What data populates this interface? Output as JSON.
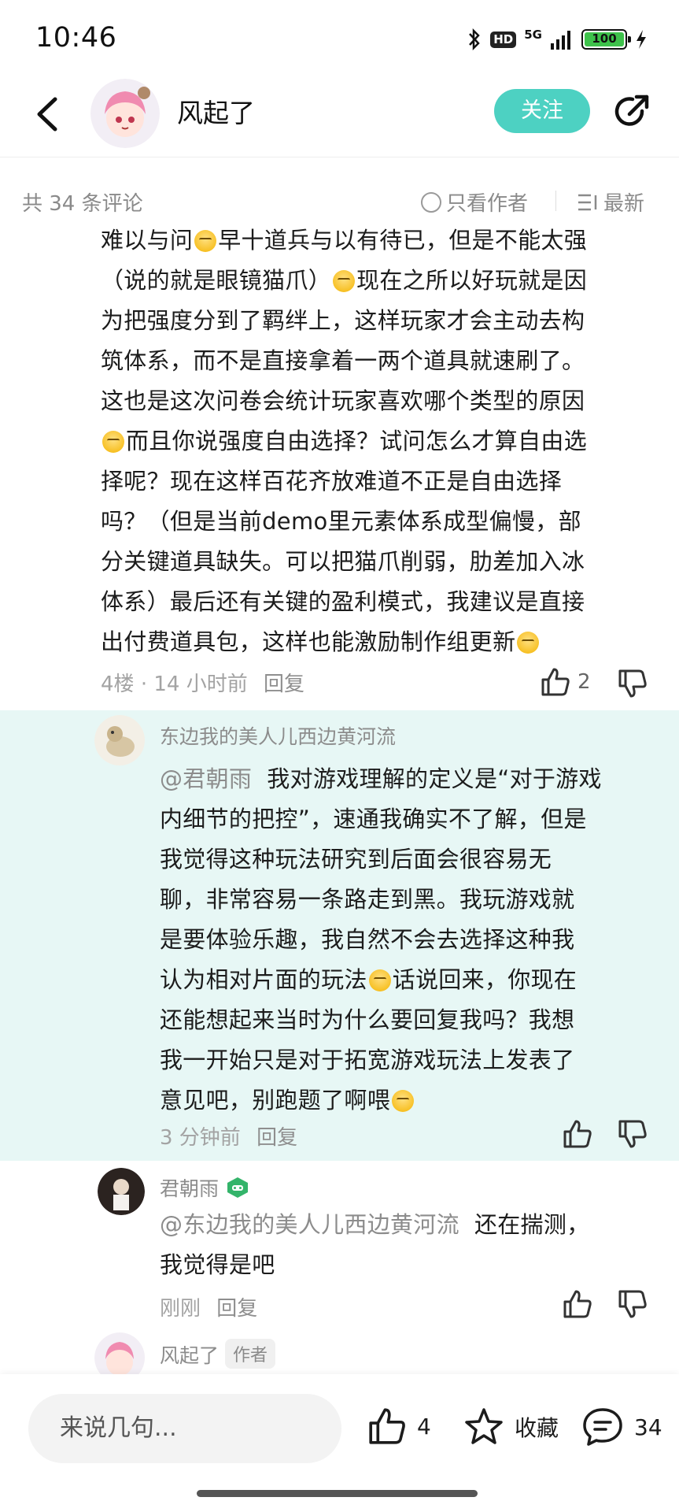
{
  "status_bar": {
    "time": "10:46",
    "hd": "HD",
    "network": "5G",
    "battery": "100"
  },
  "header": {
    "title": "风起了",
    "follow_label": "关注"
  },
  "comment_bar": {
    "count": "共 34 条评论",
    "author_only": "只看作者",
    "sort": "最新"
  },
  "main_comment": {
    "lines": [
      "难以与问",
      "早十道兵与以有待已，但是不能太强",
      "（说的就是眼镜猫爪）",
      "现在之所以好玩就是因",
      "为把强度分到了羁绊上，这样玩家才会主动去构",
      "筑体系，而不是直接拿着一两个道具就速刷了。",
      "这也是这次问卷会统计玩家喜欢哪个类型的原因",
      "而且你说强度自由选择？试问怎么才算自由选",
      "择呢？现在这样百花齐放难道不正是自由选择",
      "吗？（但是当前demo里元素体系成型偏慢，部",
      "分关键道具缺失。可以把猫爪削弱，肋差加入冰",
      "体系）最后还有关键的盈利模式，我建议是直接",
      "出付费道具包，这样也能激励制作组更新"
    ],
    "floor": "4楼",
    "dot": "·",
    "time": "14 小时前",
    "reply": "回复",
    "likes": "2"
  },
  "reply_1": {
    "name": "东边我的美人儿西边黄河流",
    "mention": "@君朝雨",
    "lines": [
      "  我对游戏理解的定义是“对于游戏",
      "内细节的把控”，速通我确实不了解，但是",
      "我觉得这种玩法研究到后面会很容易无",
      "聊，非常容易一条路走到黑。我玩游戏就",
      "是要体验乐趣，我自然不会去选择这种我",
      "认为相对片面的玩法",
      "话说回来，你现在",
      "还能想起来当时为什么要回复我吗？我想",
      "我一开始只是对于拓宽游戏玩法上发表了",
      "意见吧，别跑题了啊喂"
    ],
    "time": "3 分钟前",
    "reply": "回复"
  },
  "reply_2": {
    "name": "君朝雨",
    "mention": "@东边我的美人儿西边黄河流",
    "line1": "  还在揣测，",
    "line2": "我觉得是吧",
    "time": "刚刚",
    "reply": "回复"
  },
  "reply_3": {
    "name": "风起了",
    "tag": "作者"
  },
  "bottom_bar": {
    "input_placeholder": "来说几句...",
    "like_count": "4",
    "collect_label": "收藏",
    "comment_count": "34"
  },
  "colors": {
    "accent": "#4dd1c2",
    "reply_bg": "#e7f7f5",
    "meta_gray": "#a3a3a3"
  }
}
